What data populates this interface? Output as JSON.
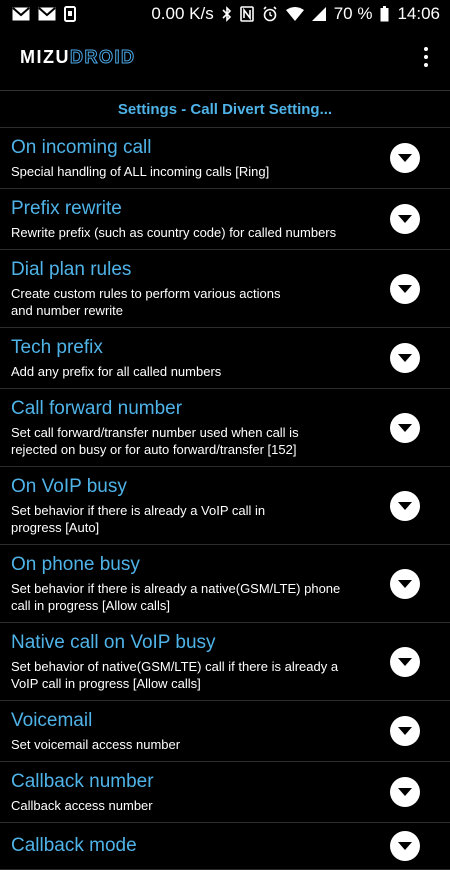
{
  "status_bar": {
    "speed": "0.00 K/s",
    "battery": "70 %",
    "time": "14:06"
  },
  "app_bar": {
    "logo_part1": "MIZU",
    "logo_part2": "DROID"
  },
  "section_title": "Settings - Call Divert Setting...",
  "items": [
    {
      "title": "On incoming call",
      "subtitle": "Special handling of ALL incoming calls [Ring]"
    },
    {
      "title": "Prefix rewrite",
      "subtitle": "Rewrite prefix (such as country code) for called numbers"
    },
    {
      "title": "Dial plan rules",
      "subtitle": "Create custom rules to perform various actions\nand number rewrite"
    },
    {
      "title": "Tech prefix",
      "subtitle": "Add any prefix for all called numbers"
    },
    {
      "title": "Call forward number",
      "subtitle": "Set call forward/transfer number used when call is\nrejected on busy or for auto forward/transfer [152]"
    },
    {
      "title": "On VoIP busy",
      "subtitle": "Set behavior if there is already a VoIP call in\nprogress [Auto]"
    },
    {
      "title": "On phone busy",
      "subtitle": "Set behavior if there is already a native(GSM/LTE) phone\ncall in progress [Allow calls]"
    },
    {
      "title": "Native call on VoIP busy",
      "subtitle": "Set behavior of native(GSM/LTE) call if there is already a\nVoIP call in progress [Allow calls]"
    },
    {
      "title": "Voicemail",
      "subtitle": "Set voicemail access number"
    },
    {
      "title": "Callback number",
      "subtitle": "Callback access number"
    },
    {
      "title": "Callback mode",
      "subtitle": ""
    }
  ],
  "colors": {
    "accent": "#4fb3e8",
    "background": "#000000"
  }
}
